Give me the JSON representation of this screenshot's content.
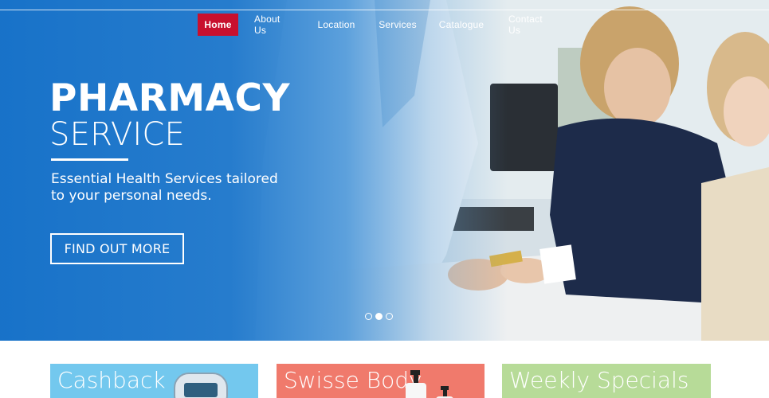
{
  "nav": {
    "items": [
      {
        "label": "Home",
        "active": true
      },
      {
        "label": "About Us",
        "active": false
      },
      {
        "label": "Location",
        "active": false
      },
      {
        "label": "Services",
        "active": false
      },
      {
        "label": "Catalogue",
        "active": false
      },
      {
        "label": "Contact Us",
        "active": false
      }
    ]
  },
  "hero": {
    "title": "PHARMACY",
    "subtitle": "SERVICE",
    "tagline": "Essential Health Services tailored to your personal needs.",
    "button_label": "FIND OUT MORE",
    "slides": {
      "count": 3,
      "active_index": 1
    }
  },
  "promos": [
    {
      "title": "Cashback",
      "color": "#73c8ee"
    },
    {
      "title": "Swisse Body",
      "color": "#f07a6c"
    },
    {
      "title": "Weekly Specials",
      "color": "#b7db98"
    }
  ],
  "colors": {
    "accent_red": "#c8102e",
    "hero_blue": "#1470c8"
  }
}
